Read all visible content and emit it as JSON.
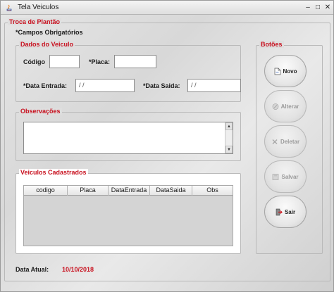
{
  "window": {
    "title": "Tela Veiculos",
    "minimize": "–",
    "maximize": "□",
    "close": "✕"
  },
  "main_group": {
    "legend": "Troca de Plantão",
    "required_note": "*Campos Obrigatórios"
  },
  "vehicle_data": {
    "legend": "Dados do Veiculo",
    "codigo_label": "Código",
    "codigo_value": "",
    "placa_label": "*Placa:",
    "placa_value": "",
    "data_entrada_label": "*Data Entrada:",
    "data_entrada_value": " /  /",
    "data_saida_label": "*Data Saida:",
    "data_saida_value": " /  /"
  },
  "observations": {
    "legend": "Observações",
    "value": ""
  },
  "registered_vehicles": {
    "legend": "Veiculos Cadastrados",
    "columns": [
      "codigo",
      "Placa",
      "DataEntrada",
      "DataSaida",
      "Obs"
    ],
    "rows": []
  },
  "buttons_group": {
    "legend": "Botões",
    "novo": "Novo",
    "alterar": "Alterar",
    "deletar": "Deletar",
    "salvar": "Salvar",
    "sair": "Sair"
  },
  "status": {
    "label": "Data Atual:",
    "date": "10/10/2018"
  },
  "colors": {
    "legend_red": "#c8101e",
    "sair_icon_red": "#d0161e",
    "novo_icon_blue": "#3a67b8"
  }
}
